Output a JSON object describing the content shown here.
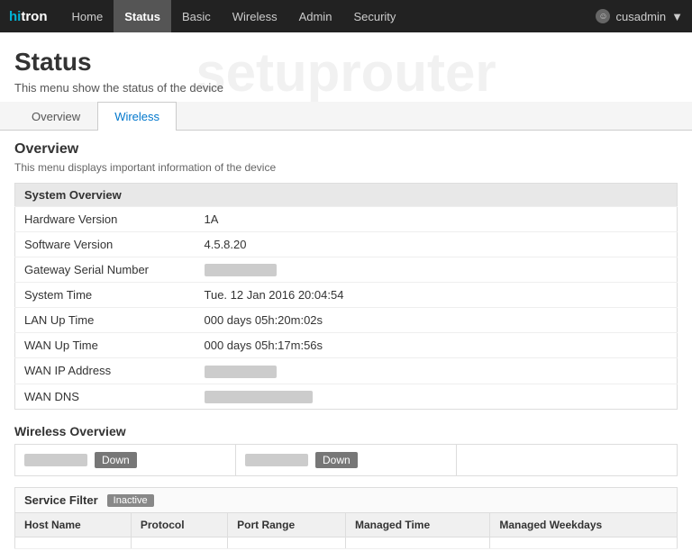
{
  "navbar": {
    "brand": "hitron",
    "brand_hi": "hi",
    "brand_tron": "tron",
    "items": [
      {
        "label": "Home",
        "active": false
      },
      {
        "label": "Status",
        "active": true
      },
      {
        "label": "Basic",
        "active": false
      },
      {
        "label": "Wireless",
        "active": false
      },
      {
        "label": "Admin",
        "active": false
      },
      {
        "label": "Security",
        "active": false
      }
    ],
    "user": "cusadmin"
  },
  "watermark": "setuprouter",
  "page": {
    "title": "Status",
    "subtitle": "This menu show the status of the device"
  },
  "tabs": [
    {
      "label": "Overview",
      "active": false
    },
    {
      "label": "Wireless",
      "active": true
    }
  ],
  "overview": {
    "title": "Overview",
    "subtitle": "This menu displays important information of the device",
    "system_section": "System Overview",
    "rows": [
      {
        "label": "Hardware Version",
        "value": "1A",
        "blurred": false
      },
      {
        "label": "Software Version",
        "value": "4.5.8.20",
        "blurred": false
      },
      {
        "label": "Gateway Serial Number",
        "value": "",
        "blurred": true
      },
      {
        "label": "System Time",
        "value": "Tue. 12 Jan 2016 20:04:54",
        "blurred": false
      },
      {
        "label": "LAN Up Time",
        "value": "000 days 05h:20m:02s",
        "blurred": false
      },
      {
        "label": "WAN Up Time",
        "value": "000 days 05h:17m:56s",
        "blurred": false
      },
      {
        "label": "WAN IP Address",
        "value": "",
        "blurred": true
      },
      {
        "label": "WAN DNS",
        "value": "",
        "blurred": true,
        "long": true
      }
    ]
  },
  "wireless_overview": {
    "title": "Wireless Overview",
    "cells": [
      {
        "ssid_blurred": true,
        "btn_label": "Down"
      },
      {
        "ssid_blurred": true,
        "btn_label": "Down"
      },
      {
        "ssid_blurred": false,
        "empty": true
      }
    ]
  },
  "service_filter": {
    "label": "Service Filter",
    "status": "Inactive",
    "columns": [
      "Host Name",
      "Protocol",
      "Port Range",
      "Managed Time",
      "Managed Weekdays"
    ]
  }
}
